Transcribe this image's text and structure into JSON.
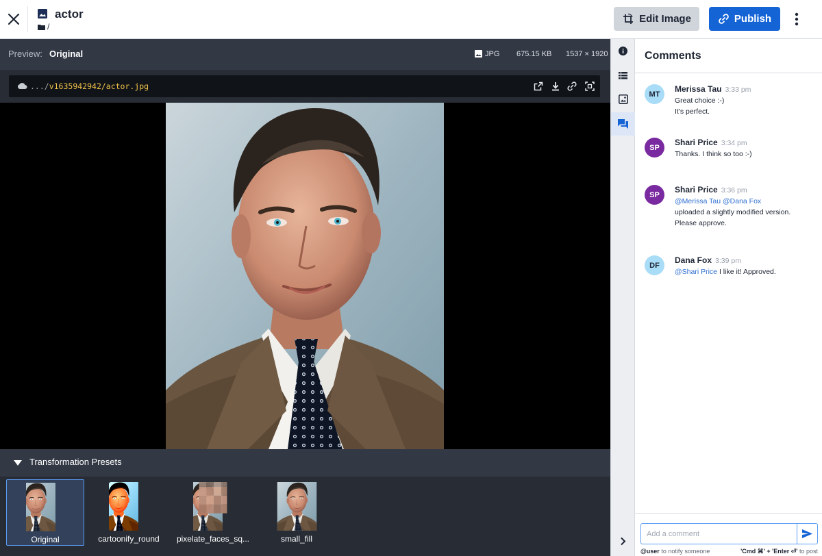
{
  "header": {
    "title": "actor",
    "folder_path": "/",
    "edit_label": "Edit Image",
    "publish_label": "Publish"
  },
  "preview": {
    "label": "Preview:",
    "value": "Original",
    "format": "JPG",
    "file_size": "675.15 KB",
    "dimensions": "1537 × 1920",
    "url_prefix": ".../",
    "url_path": "v1635942942/actor.jpg"
  },
  "presets": {
    "title": "Transformation Presets",
    "items": [
      {
        "name": "Original"
      },
      {
        "name": "cartoonify_round"
      },
      {
        "name": "pixelate_faces_sq..."
      },
      {
        "name": "small_fill"
      }
    ]
  },
  "comments": {
    "title": "Comments",
    "items": [
      {
        "initials": "MT",
        "author": "Merissa Tau",
        "time": "3:33 pm",
        "line1": "Great choice :-)",
        "line2": "It's perfect."
      },
      {
        "initials": "SP",
        "author": "Shari Price",
        "time": "3:34 pm",
        "line1": "Thanks. I think so too :-)"
      },
      {
        "initials": "SP",
        "author": "Shari Price",
        "time": "3:36 pm",
        "mention1": "@Merissa Tau",
        "mention2": "@Dana Fox",
        "line2": "uploaded a slightly modified version.",
        "line3": "Please approve."
      },
      {
        "initials": "DF",
        "author": "Dana Fox",
        "time": "3:39 pm",
        "mention1": "@Shari Price",
        "line1": "I like it! Approved."
      }
    ],
    "input_placeholder": "Add a comment",
    "hint_user": "@user",
    "hint_user_text": "to notify someone",
    "hint_keys": "'Cmd ⌘' + 'Enter ⏎'",
    "hint_keys_text": "to post"
  },
  "colors": {
    "accent": "#1464d6",
    "dark_panel": "#323844",
    "url_path": "#f0c24a",
    "mention": "#2f6fd0",
    "avatar_light": "#a9dcf7",
    "avatar_purple": "#7a2aa0"
  },
  "icons": [
    "close-icon",
    "image-icon",
    "folder-icon",
    "crop-rotate-icon",
    "link-icon",
    "more-vert-icon",
    "cloud-icon",
    "open-external-icon",
    "download-icon",
    "copy-link-icon",
    "focus-frame-icon",
    "info-icon",
    "list-icon",
    "gallery-icon",
    "chat-icon",
    "chevron-right-icon",
    "send-icon"
  ]
}
